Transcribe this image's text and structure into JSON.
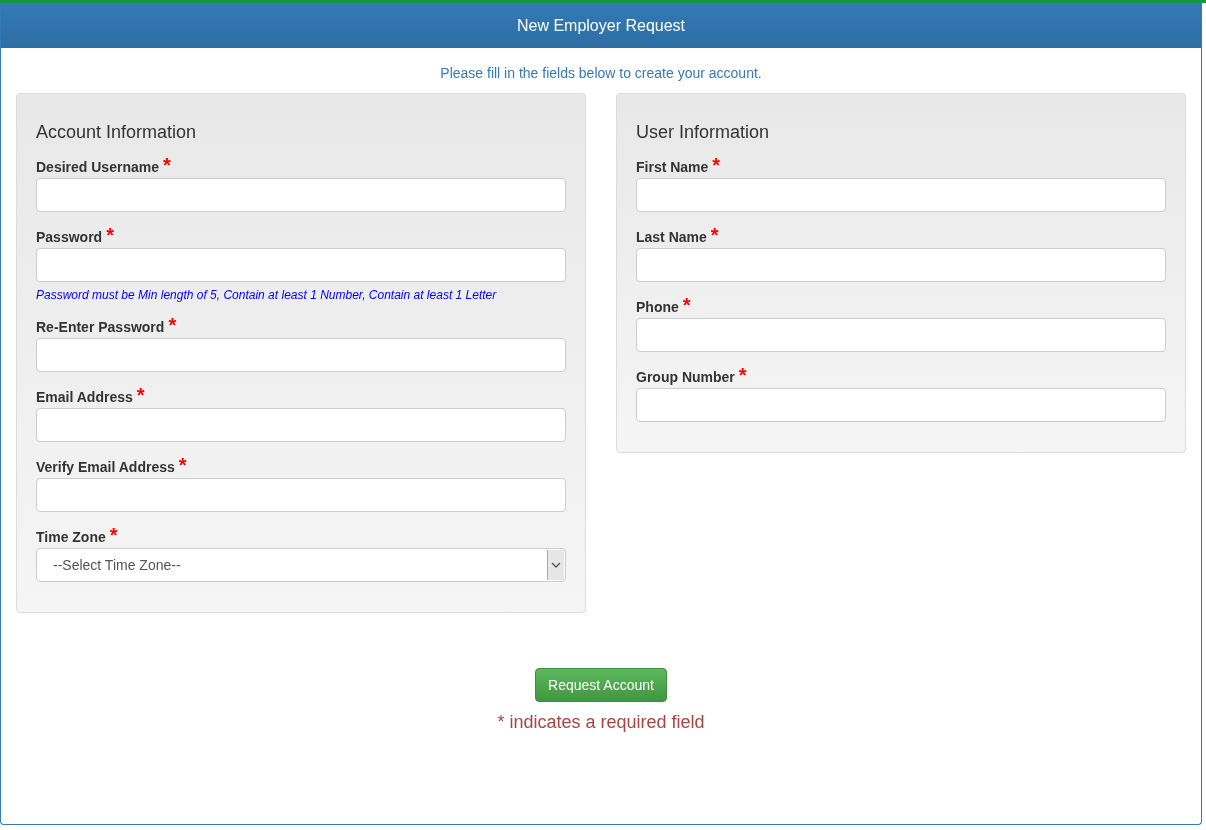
{
  "header": {
    "title": "New Employer Request"
  },
  "intro": "Please fill in the fields below to create your account.",
  "panels": [
    {
      "title": "Account Information",
      "fields": [
        {
          "kind": "text",
          "label": "Desired Username",
          "mark": "*"
        },
        {
          "kind": "text",
          "label": "Password",
          "mark": "*",
          "hint": "Password must be Min length of 5, Contain at least 1 Number, Contain at least 1 Letter"
        },
        {
          "kind": "text",
          "label": "Re-Enter Password",
          "mark": "*"
        },
        {
          "kind": "text",
          "label": "Email Address",
          "mark": "*"
        },
        {
          "kind": "text",
          "label": "Verify Email Address",
          "mark": "*"
        },
        {
          "kind": "select",
          "label": "Time Zone",
          "mark": "*",
          "value": "--Select Time Zone--"
        }
      ]
    },
    {
      "title": "User Information",
      "fields": [
        {
          "kind": "text",
          "label": "First Name",
          "mark": "*"
        },
        {
          "kind": "text",
          "label": "Last Name",
          "mark": "*"
        },
        {
          "kind": "text",
          "label": "Phone",
          "mark": "*"
        },
        {
          "kind": "text",
          "label": "Group Number",
          "mark": "*"
        }
      ]
    }
  ],
  "submit": "Request Account",
  "footnote": "* indicates a required field"
}
